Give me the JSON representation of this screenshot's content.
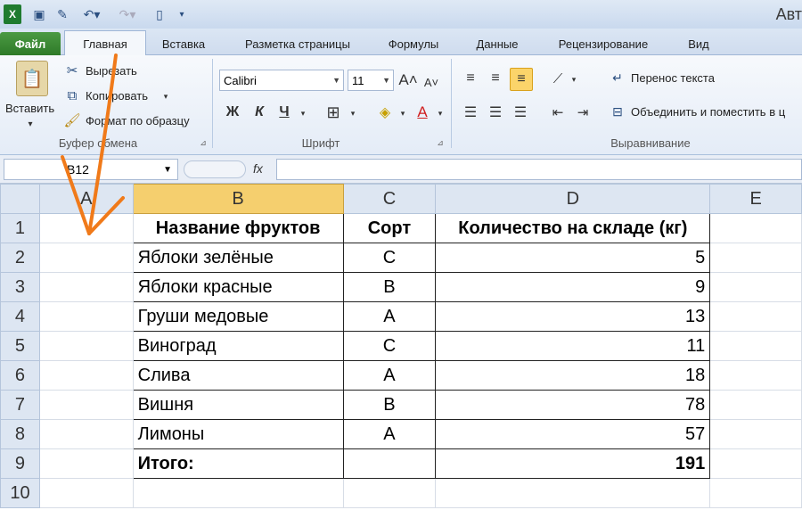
{
  "app_title": "Авт",
  "tabs": [
    "Файл",
    "Главная",
    "Вставка",
    "Разметка страницы",
    "Формулы",
    "Данные",
    "Рецензирование",
    "Вид"
  ],
  "ribbon": {
    "paste_label": "Вставить",
    "cut_label": "Вырезать",
    "copy_label": "Копировать",
    "format_painter_label": "Формат по образцу",
    "clipboard_group": "Буфер обмена",
    "font_name": "Calibri",
    "font_size": "11",
    "bold": "Ж",
    "italic": "К",
    "underline": "Ч",
    "font_group": "Шрифт",
    "wrap_text_label": "Перенос текста",
    "merge_label": "Объединить и поместить в ц",
    "alignment_group": "Выравнивание"
  },
  "formula_bar": {
    "name_box": "B12",
    "fx": "fx"
  },
  "columns": [
    "A",
    "B",
    "C",
    "D",
    "E"
  ],
  "rows": [
    {
      "n": "1",
      "a": "",
      "b": "Название фруктов",
      "c": "Сорт",
      "d": "Количество на складе (кг)"
    },
    {
      "n": "2",
      "a": "",
      "b": "Яблоки зелёные",
      "c": "C",
      "d": "5"
    },
    {
      "n": "3",
      "a": "",
      "b": "Яблоки красные",
      "c": "B",
      "d": "9"
    },
    {
      "n": "4",
      "a": "",
      "b": "Груши медовые",
      "c": "A",
      "d": "13"
    },
    {
      "n": "5",
      "a": "",
      "b": "Виноград",
      "c": "C",
      "d": "11"
    },
    {
      "n": "6",
      "a": "",
      "b": "Слива",
      "c": "A",
      "d": "18"
    },
    {
      "n": "7",
      "a": "",
      "b": "Вишня",
      "c": "B",
      "d": "78"
    },
    {
      "n": "8",
      "a": "",
      "b": "Лимоны",
      "c": "A",
      "d": "57"
    },
    {
      "n": "9",
      "a": "",
      "b": "Итого:",
      "c": "",
      "d": "191"
    },
    {
      "n": "10",
      "a": "",
      "b": "",
      "c": "",
      "d": ""
    }
  ],
  "colors": {
    "accent": "#f5cf6e",
    "file_tab": "#2e7a28",
    "arrow": "#f07a1a"
  }
}
